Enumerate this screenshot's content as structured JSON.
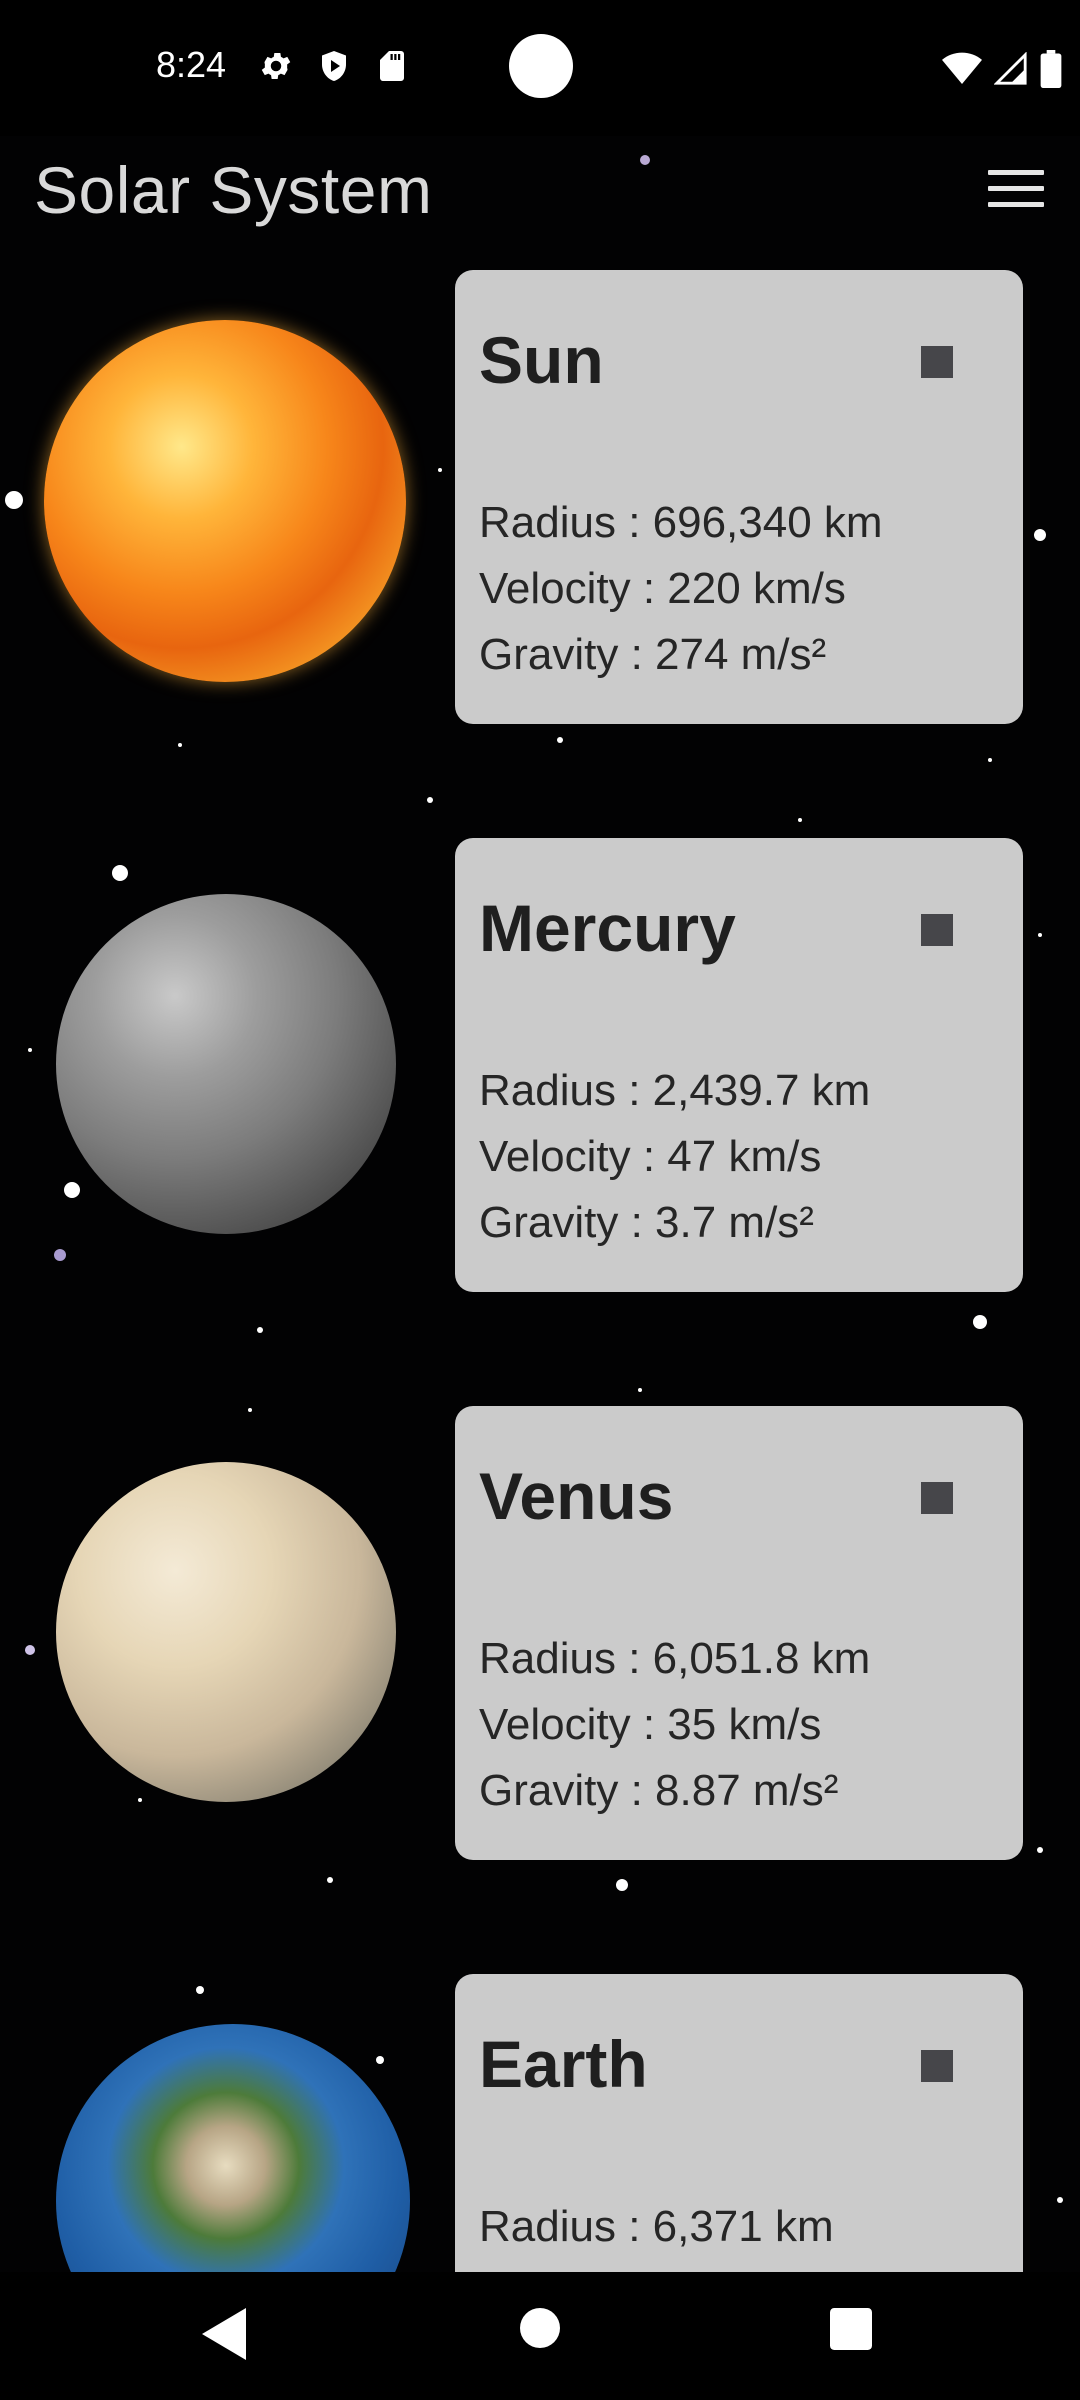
{
  "status_bar": {
    "time": "8:24",
    "left_icons": [
      "settings-icon",
      "shield-play-icon",
      "sd-card-icon"
    ],
    "right_icons": [
      "wifi-icon",
      "cellular-signal-icon",
      "battery-icon"
    ]
  },
  "app_bar": {
    "title": "Solar System",
    "menu_icon": "hamburger-menu-icon"
  },
  "planets": [
    {
      "name": "Sun",
      "radius": "Radius : 696,340 km",
      "velocity": "Velocity : 220 km/s",
      "gravity": "Gravity : 274 m/s²"
    },
    {
      "name": "Mercury",
      "radius": "Radius : 2,439.7 km",
      "velocity": "Velocity : 47 km/s",
      "gravity": "Gravity : 3.7 m/s²"
    },
    {
      "name": "Venus",
      "radius": "Radius : 6,051.8 km",
      "velocity": "Velocity : 35 km/s",
      "gravity": "Gravity : 8.87 m/s²"
    },
    {
      "name": "Earth",
      "radius": "Radius : 6,371 km",
      "velocity": "",
      "gravity": ""
    }
  ],
  "nav_bar": {
    "icons": [
      "back-icon",
      "home-icon",
      "recents-icon"
    ]
  },
  "colors": {
    "card_background": "#cbcbcb",
    "title_color": "#d9d9d9",
    "background": "#020203"
  }
}
